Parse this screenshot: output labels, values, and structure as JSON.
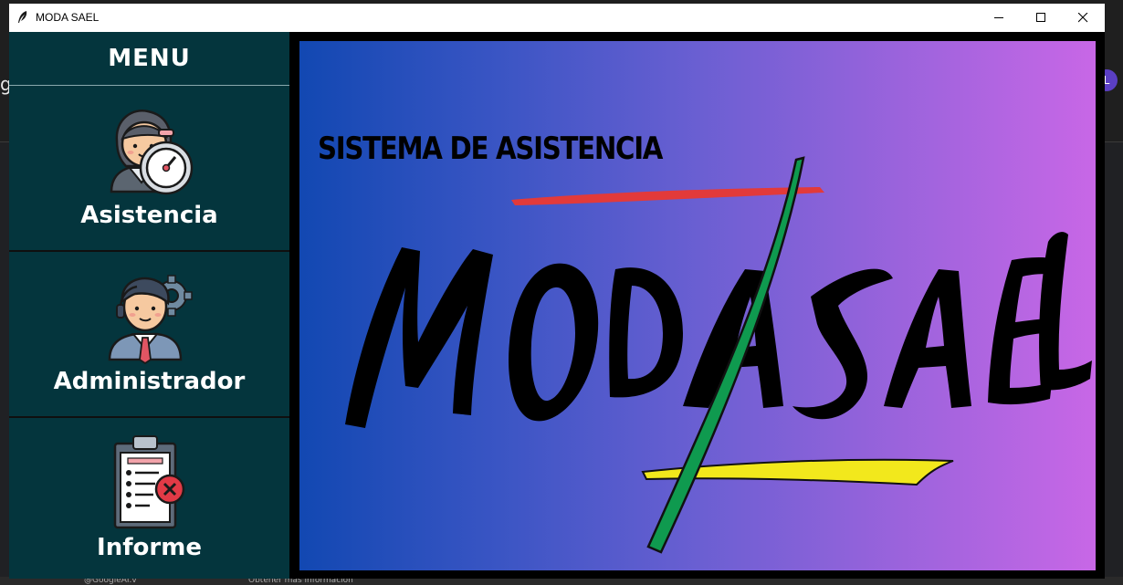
{
  "window": {
    "title": "MODA SAEL",
    "minimize_label": "minimize",
    "maximize_label": "maximize",
    "close_label": "close"
  },
  "background": {
    "left_letter": "g",
    "avatar_letter": "L",
    "footer_texts": [
      "@GoogleAI.v",
      "Obtener más información"
    ]
  },
  "sidebar": {
    "header": "MENU",
    "items": [
      {
        "label": "Asistencia",
        "icon": "clock-user-icon"
      },
      {
        "label": "Administrador",
        "icon": "admin-user-icon"
      },
      {
        "label": "Informe",
        "icon": "report-clipboard-icon"
      }
    ]
  },
  "banner": {
    "subtitle": "SISTEMA DE ASISTENCIA",
    "logo_text": "MODA SAEL",
    "colors": {
      "gradient_start": "#1248b2",
      "gradient_end": "#c867e6",
      "accent_red": "#e23a3a",
      "accent_green": "#0f9a4f",
      "accent_yellow": "#f2e81c"
    }
  },
  "colors": {
    "sidebar_bg": "#04353d",
    "titlebar_bg": "#ffffff"
  }
}
